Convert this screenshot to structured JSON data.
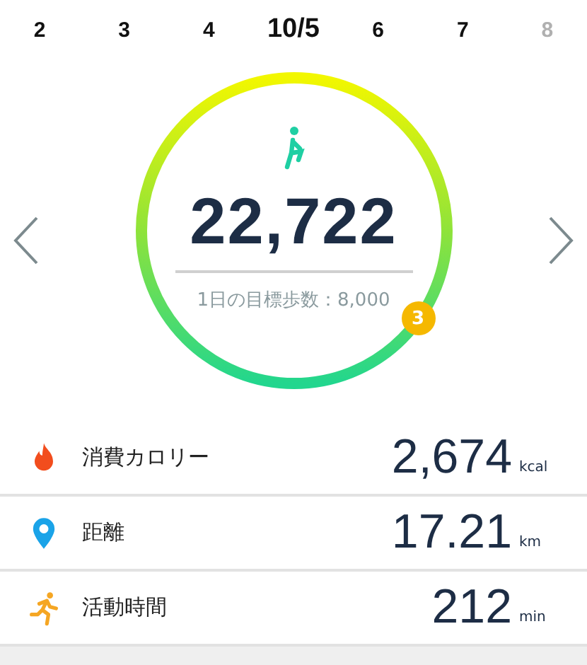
{
  "days": [
    {
      "label": "2",
      "selected": false,
      "disabled": false
    },
    {
      "label": "3",
      "selected": false,
      "disabled": false
    },
    {
      "label": "4",
      "selected": false,
      "disabled": false
    },
    {
      "label": "10/5",
      "selected": true,
      "disabled": false
    },
    {
      "label": "6",
      "selected": false,
      "disabled": false
    },
    {
      "label": "7",
      "selected": false,
      "disabled": false
    },
    {
      "label": "8",
      "selected": false,
      "disabled": true
    }
  ],
  "steps": {
    "value": "22,722",
    "goal": "1日の目標歩数：8,000",
    "level": 1,
    "badge": "3"
  },
  "metrics": [
    {
      "kind": "calories",
      "label": "消費カロリー",
      "value": "2,674",
      "unit": "kcal"
    },
    {
      "kind": "distance",
      "label": "距離",
      "value": "17.21",
      "unit": "km"
    },
    {
      "kind": "active",
      "label": "活動時間",
      "value": "212",
      "unit": "min"
    }
  ]
}
